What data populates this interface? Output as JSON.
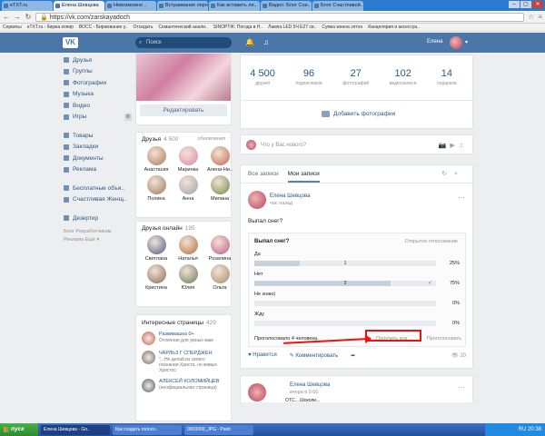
{
  "browser": {
    "tabs": [
      {
        "label": "eTXT.ru",
        "active": false
      },
      {
        "label": "Елена Шевцова",
        "active": true
      },
      {
        "label": "Невозможно ..",
        "active": false
      },
      {
        "label": "Встраивание опрос",
        "active": false
      },
      {
        "label": "Как вставить ли..",
        "active": false
      },
      {
        "label": "Видео: Блог Сни..",
        "active": false
      },
      {
        "label": "Блог Счастливой..",
        "active": false
      }
    ],
    "window_buttons": [
      "–",
      "▢",
      "✕"
    ],
    "url": "https://vk.com/zarskayadoch",
    "url_scheme": "https://",
    "bookmarks": [
      "Сервисы",
      "eTXT.ru - биржа копир",
      "ВОСС - Биржевание у..",
      "Отсидать",
      "Семантический анали..",
      "SINOPTIK: Погода в Н..",
      "Лампа LED 5Ч Е27 св..",
      "Сумка женна эптон",
      "Канцелярия и аксессуа.."
    ]
  },
  "vk_header": {
    "logo": "VK",
    "search_placeholder": "Поиск",
    "user_name": "Елена"
  },
  "left_menu": {
    "group1": [
      {
        "label": "Друзья",
        "icon": "friends-icon"
      },
      {
        "label": "Группы",
        "icon": "groups-icon"
      },
      {
        "label": "Фотографии",
        "icon": "photos-icon"
      },
      {
        "label": "Музыка",
        "icon": "music-icon"
      },
      {
        "label": "Видео",
        "icon": "video-icon"
      },
      {
        "label": "Игры",
        "icon": "games-icon"
      }
    ],
    "group2": [
      {
        "label": "Товары",
        "icon": "goods-icon"
      },
      {
        "label": "Закладки",
        "icon": "bookmarks-icon"
      },
      {
        "label": "Документы",
        "icon": "documents-icon"
      },
      {
        "label": "Реклама",
        "icon": "ads-icon"
      }
    ],
    "group3": [
      {
        "label": "Бесплатные объя..",
        "icon": "app-icon"
      },
      {
        "label": "Счастливая Женщ..",
        "icon": "app-icon"
      }
    ],
    "group4": [
      {
        "label": "Дезертир",
        "icon": "app-icon"
      }
    ],
    "footer": "Блог  Разработчикам\nРеклама  Ещё ▾"
  },
  "profile": {
    "edit_button": "Редактировать",
    "friends_title": "Друзья",
    "friends_count": "4 500",
    "friends_updates": "обновления",
    "friends": [
      {
        "name": "Анастасия",
        "color": "#b07a5a"
      },
      {
        "name": "Маринка",
        "color": "#d98aa3"
      },
      {
        "name": "Алена-Ни..",
        "color": "#c06a4e"
      },
      {
        "name": "Полина",
        "color": "#9a7a62"
      },
      {
        "name": "Анна",
        "color": "#a5a0b0"
      },
      {
        "name": "Милана",
        "color": "#6f8a4a"
      }
    ],
    "online_title": "Друзья онлайн",
    "online_count": "195",
    "online": [
      {
        "name": "Светлана",
        "color": "#4a5e8a"
      },
      {
        "name": "Наталья",
        "color": "#b06f3a"
      },
      {
        "name": "Розалина",
        "color": "#c05a8a"
      },
      {
        "name": "Кристина",
        "color": "#8a6a5a"
      },
      {
        "name": "Юлия",
        "color": "#6a7a5a"
      },
      {
        "name": "Ольга",
        "color": "#a48a6a"
      }
    ],
    "pages_title": "Интересные страницы",
    "pages_count": "429",
    "pages": [
      {
        "title": "Развивашка 0+",
        "sub": "Отличная для умных мам",
        "color": "#d25a4a"
      },
      {
        "title": "ЧАРЛЬЗ Г СПЕРДЖЕН",
        "sub": "\"...Не делай из своего познания Христа, но живых Христос",
        "color": "#7a6a5a"
      },
      {
        "title": "АЛЕКСЕЙ КОЛОМИЙЦЕВ",
        "sub": "(неофициальная страница)",
        "color": "#5a5a5a"
      }
    ]
  },
  "stats": [
    {
      "n": "4 500",
      "l": "друзей"
    },
    {
      "n": "96",
      "l": "подписчиков"
    },
    {
      "n": "27",
      "l": "фотографий"
    },
    {
      "n": "102",
      "l": "видеозаписи"
    },
    {
      "n": "14",
      "l": "подарков"
    }
  ],
  "add_photo": "Добавить фотографии",
  "composer_placeholder": "Что у Вас нового?",
  "feed": {
    "tabs": [
      "Все записи",
      "Мои записи"
    ],
    "author": "Елена Шевцова",
    "time": "час назад",
    "question": "Выпал снег?",
    "poll": {
      "title": "Выпал снег?",
      "type": "Открытое голосование",
      "options": [
        {
          "label": "Да",
          "count": "1",
          "pct": "25%",
          "fraction": 0.25,
          "checked": false
        },
        {
          "label": "Нет",
          "count": "3",
          "pct": "75%",
          "fraction": 0.75,
          "checked": true
        },
        {
          "label": "Не знаю)",
          "count": "",
          "pct": "0%",
          "fraction": 0,
          "checked": false
        },
        {
          "label": "Жду",
          "count": "",
          "pct": "0%",
          "fraction": 0,
          "checked": false
        }
      ],
      "voted": "Проголосовало 4 человека.",
      "cancel": "Получить код",
      "revote": "Проголосовать"
    },
    "like": "Нравится",
    "comment": "Комментировать",
    "views": "20"
  },
  "feed2": {
    "author": "Елена Шевцова",
    "time": "вчера в 9:00",
    "sub": "ОТС... Шоколи..."
  },
  "taskbar": {
    "start": "пуск",
    "items": [
      {
        "label": "Елена Шевцова - Go..",
        "active": true
      },
      {
        "label": "Как создать голосо..",
        "active": false
      },
      {
        "label": "0000000_JPG - Paint",
        "active": false
      }
    ],
    "tray": "RU  20:38"
  }
}
